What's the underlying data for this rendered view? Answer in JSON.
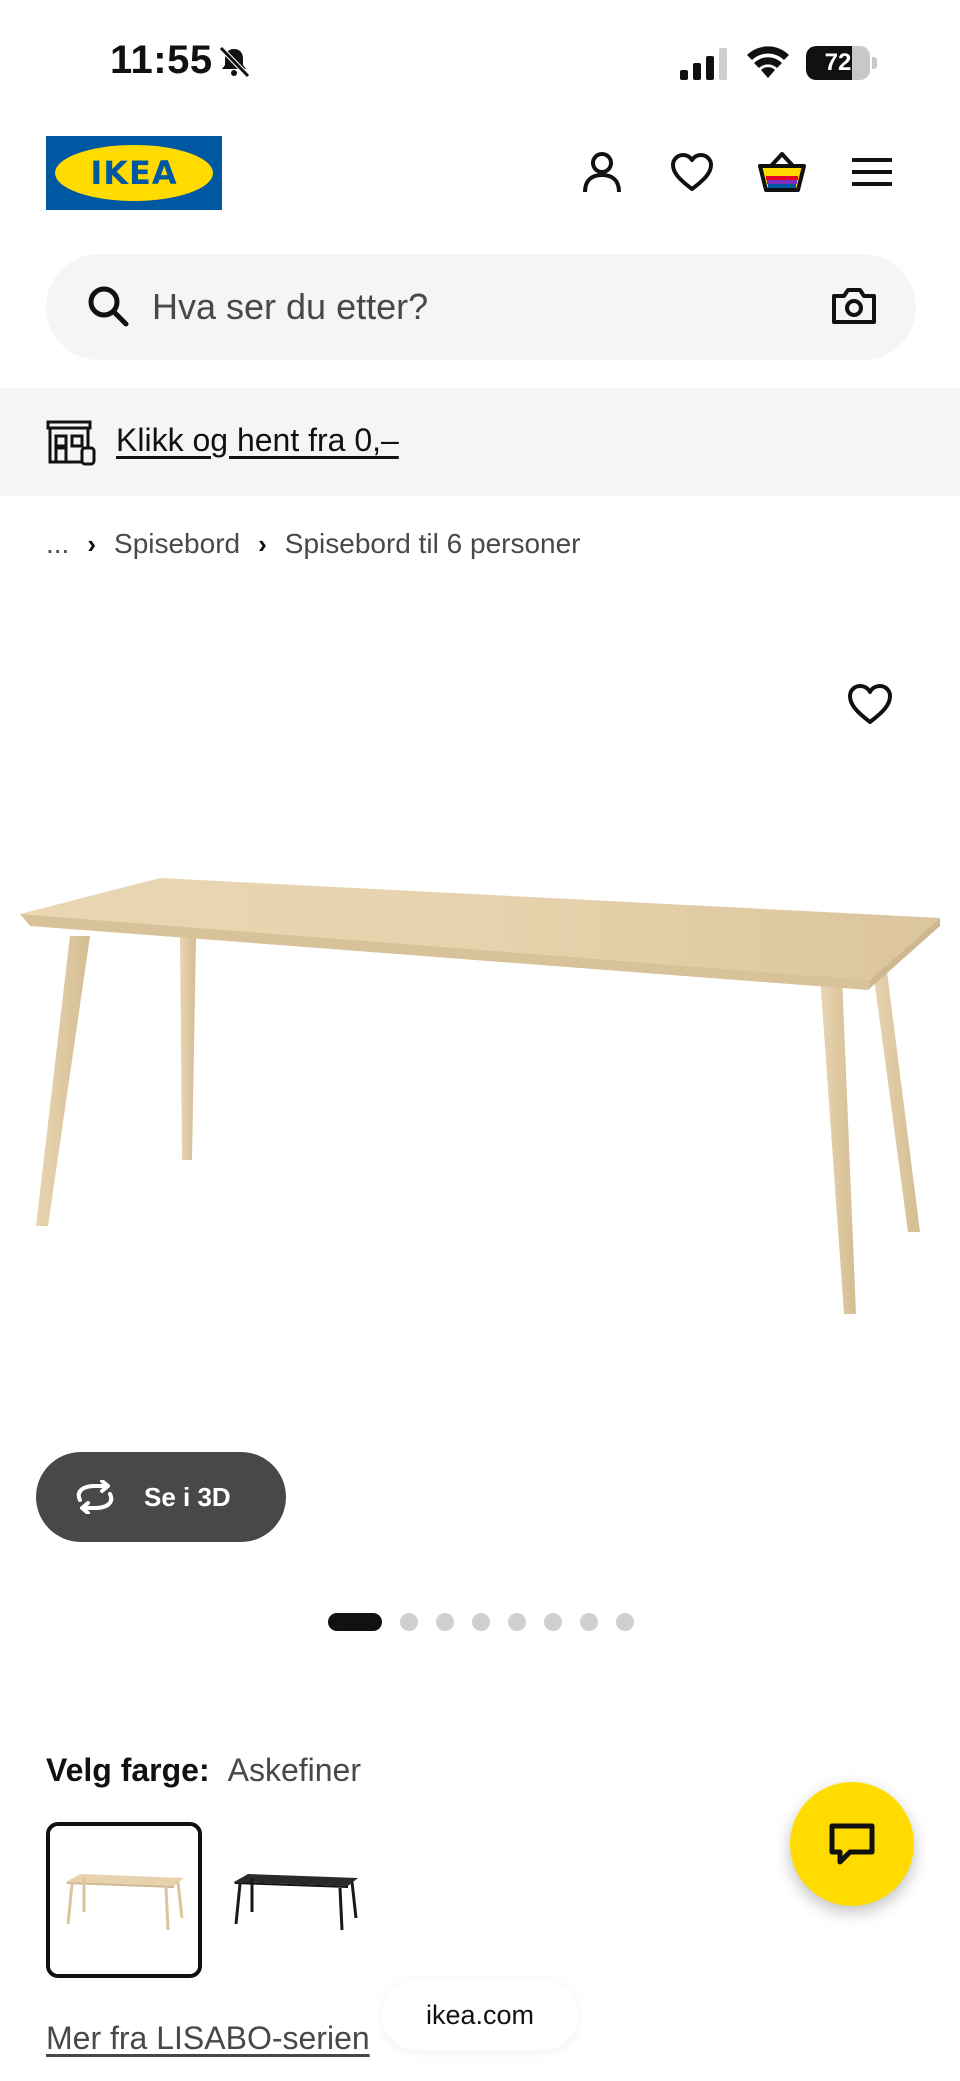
{
  "status_bar": {
    "time": "11:55",
    "battery": "72",
    "battery_level": 0.72
  },
  "header": {
    "logo_text": "IKEA",
    "icons": [
      "account-icon",
      "heart-icon",
      "basket-icon",
      "menu-icon"
    ]
  },
  "search": {
    "placeholder": "Hva ser du etter?"
  },
  "promo": {
    "text": "Klikk og hent fra 0,–"
  },
  "breadcrumb": {
    "items": [
      "...",
      "Spisebord",
      "Spisebord til 6 personer"
    ]
  },
  "gallery": {
    "view_3d_label": "Se i 3D",
    "image_count": 8,
    "active_index": 0
  },
  "color": {
    "label": "Velg farge:",
    "value": "Askefiner",
    "swatches": [
      "ash-veneer",
      "black"
    ]
  },
  "more_link": "Mer fra LISABO-serien",
  "browser": {
    "url": "ikea.com"
  },
  "colors": {
    "brand_blue": "#0058a3",
    "brand_yellow": "#ffdb00"
  }
}
